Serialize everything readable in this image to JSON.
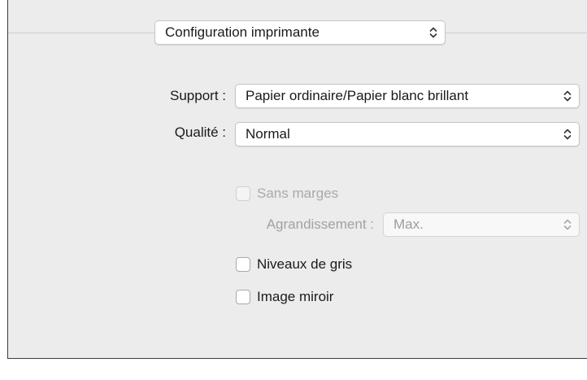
{
  "header": {
    "preset_popup": {
      "value": "Configuration imprimante",
      "icon": "chevron-updown-icon"
    }
  },
  "fields": {
    "support": {
      "label": "Support :",
      "value": "Papier ordinaire/Papier blanc brillant"
    },
    "qualite": {
      "label": "Qualité :",
      "value": "Normal"
    },
    "sans_marges": {
      "label": "Sans marges",
      "checked": false,
      "enabled": false
    },
    "agrandissement": {
      "label": "Agrandissement :",
      "value": "Max.",
      "enabled": false
    },
    "niveaux_de_gris": {
      "label": "Niveaux de gris",
      "checked": false
    },
    "image_miroir": {
      "label": "Image miroir",
      "checked": false
    }
  },
  "colors": {
    "panel_bg": "#ececec",
    "border": "#3c3c3c",
    "disabled_text": "#a2a2a2"
  }
}
